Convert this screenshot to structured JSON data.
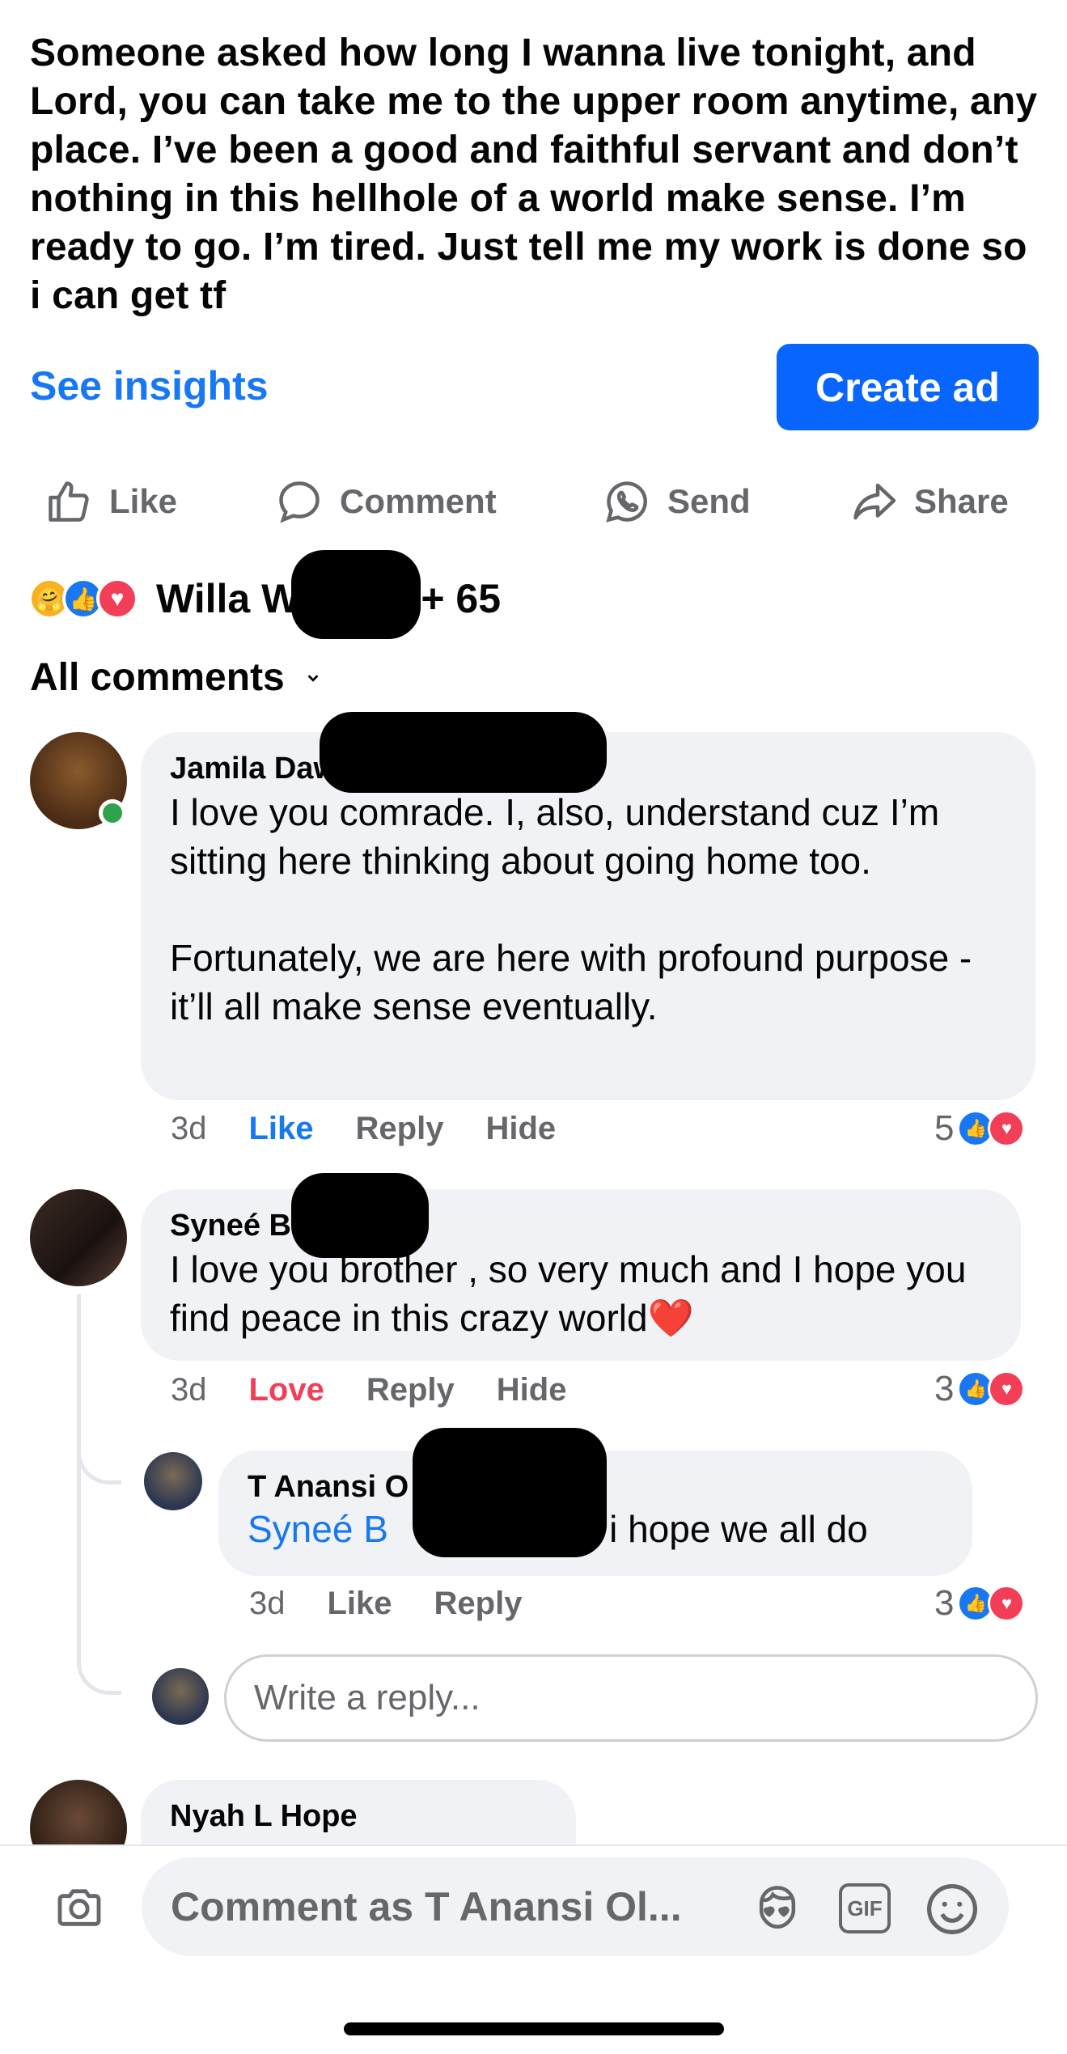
{
  "post": {
    "text": "Someone asked how long I wanna live tonight, and Lord, you can take me to the upper room anytime, any place. I’ve been a good and faithful servant and don’t nothing in this hellhole of a world make sense. I’m ready to go. I’m tired. Just tell me my work is done so i can get tf",
    "see_insights": "See insights",
    "create_ad": "Create ad"
  },
  "actions": {
    "like": "Like",
    "comment": "Comment",
    "send": "Send",
    "share": "Share"
  },
  "reactions": {
    "names": "Willa W",
    "more": "+ 65"
  },
  "comments_filter": "All comments",
  "comments": [
    {
      "name": "Jamila Dawn",
      "text_1": "I love you comrade. I, also, understand cuz I’m sitting here thinking about going home too.",
      "text_2": "Fortunately, we are here with profound purpose - it’ll all make sense eventually.",
      "time": "3d",
      "reaction_label": "Like",
      "reply": "Reply",
      "hide": "Hide",
      "count": "5"
    },
    {
      "name": "Syneé B",
      "text": "I love you brother ,  so very much and I hope you find peace in this crazy world",
      "emoji": "❤️",
      "time": "3d",
      "reaction_label": "Love",
      "reply": "Reply",
      "hide": "Hide",
      "count": "3"
    }
  ],
  "reply": {
    "name": "T Anansi O",
    "mention": "Syneé B",
    "text": "whew i hope we all do",
    "time": "3d",
    "like": "Like",
    "reply": "Reply",
    "count": "3"
  },
  "write_reply_placeholder": "Write a reply...",
  "next_comment_name": "Nyah L Hope",
  "composer": {
    "placeholder": "Comment as T Anansi Ol...",
    "gif": "GIF"
  },
  "colors": {
    "accent": "#0866FF",
    "link": "#1877F2",
    "love": "#F33E58",
    "bubble": "#F0F2F5",
    "muted": "#65676B"
  }
}
